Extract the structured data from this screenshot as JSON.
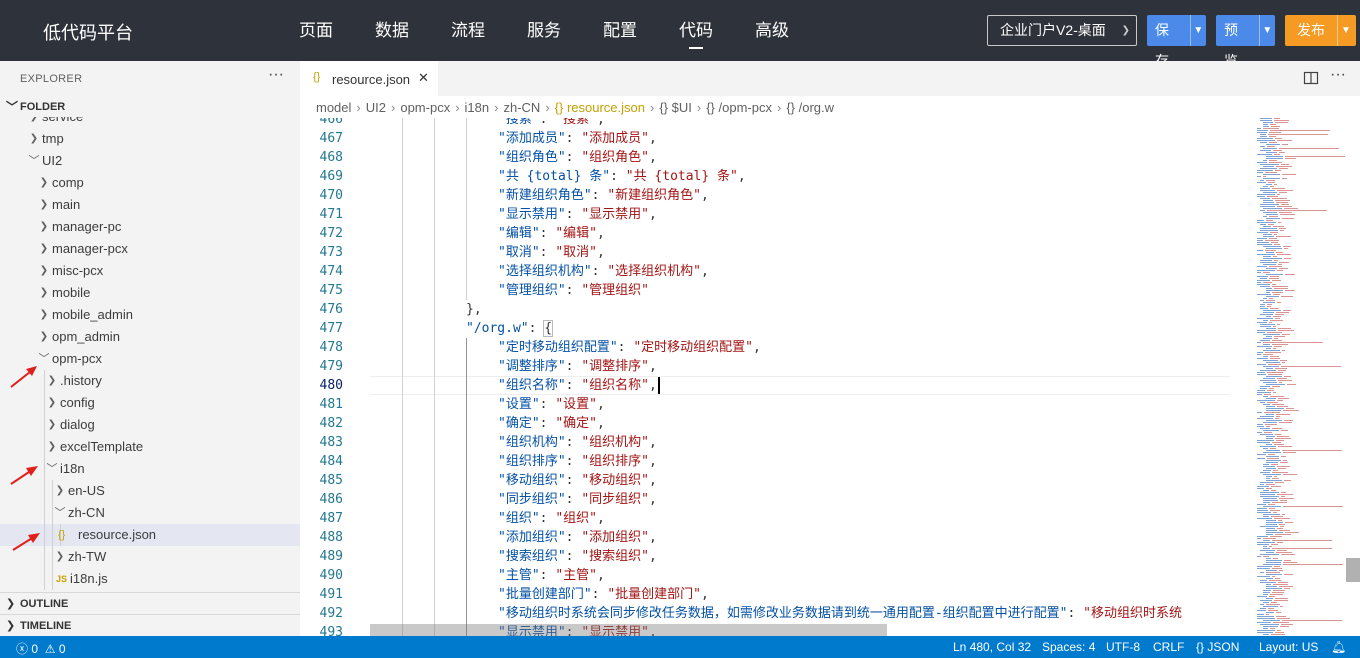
{
  "app": {
    "title": "低代码平台",
    "nav": [
      "页面",
      "数据",
      "流程",
      "服务",
      "配置",
      "代码",
      "高级"
    ],
    "active_nav": "代码",
    "env_select": "企业门户V2-桌面",
    "save_label": "保存",
    "preview_label": "预览",
    "publish_label": "发布",
    "accent_color": "#4b8ae9",
    "publish_color": "#f59a23"
  },
  "sidebar": {
    "header": "EXPLORER",
    "folder_label": "FOLDER",
    "tree": [
      {
        "label": "service",
        "indent": 1,
        "type": "folder",
        "expanded": false
      },
      {
        "label": "tmp",
        "indent": 1,
        "type": "folder",
        "expanded": false
      },
      {
        "label": "UI2",
        "indent": 1,
        "type": "folder",
        "expanded": true
      },
      {
        "label": "comp",
        "indent": 2,
        "type": "folder",
        "expanded": false
      },
      {
        "label": "main",
        "indent": 2,
        "type": "folder",
        "expanded": false
      },
      {
        "label": "manager-pc",
        "indent": 2,
        "type": "folder",
        "expanded": false
      },
      {
        "label": "manager-pcx",
        "indent": 2,
        "type": "folder",
        "expanded": false
      },
      {
        "label": "misc-pcx",
        "indent": 2,
        "type": "folder",
        "expanded": false
      },
      {
        "label": "mobile",
        "indent": 2,
        "type": "folder",
        "expanded": false
      },
      {
        "label": "mobile_admin",
        "indent": 2,
        "type": "folder",
        "expanded": false
      },
      {
        "label": "opm_admin",
        "indent": 2,
        "type": "folder",
        "expanded": false
      },
      {
        "label": "opm-pcx",
        "indent": 2,
        "type": "folder",
        "expanded": true
      },
      {
        "label": ".history",
        "indent": 3,
        "type": "folder",
        "expanded": false
      },
      {
        "label": "config",
        "indent": 3,
        "type": "folder",
        "expanded": false
      },
      {
        "label": "dialog",
        "indent": 3,
        "type": "folder",
        "expanded": false
      },
      {
        "label": "excelTemplate",
        "indent": 3,
        "type": "folder",
        "expanded": false
      },
      {
        "label": "i18n",
        "indent": 3,
        "type": "folder",
        "expanded": true
      },
      {
        "label": "en-US",
        "indent": 4,
        "type": "folder",
        "expanded": false
      },
      {
        "label": "zh-CN",
        "indent": 4,
        "type": "folder",
        "expanded": true
      },
      {
        "label": "resource.json",
        "indent": 5,
        "type": "json",
        "selected": true
      },
      {
        "label": "zh-TW",
        "indent": 4,
        "type": "folder",
        "expanded": false
      },
      {
        "label": "i18n.js",
        "indent": 4,
        "type": "js"
      }
    ],
    "outline_label": "OUTLINE",
    "timeline_label": "TIMELINE"
  },
  "editor": {
    "tab_name": "resource.json",
    "breadcrumb": [
      "model",
      "UI2",
      "opm-pcx",
      "i18n",
      "zh-CN",
      "{} resource.json",
      "{} $UI",
      "{} /opm-pcx",
      "{} /org.w"
    ],
    "current_line": 480,
    "lines": [
      {
        "n": 466,
        "indent": 4,
        "key": "搜索",
        "val": "搜索",
        "trail": ","
      },
      {
        "n": 467,
        "indent": 4,
        "key": "添加成员",
        "val": "添加成员",
        "trail": ","
      },
      {
        "n": 468,
        "indent": 4,
        "key": "组织角色",
        "val": "组织角色",
        "trail": ","
      },
      {
        "n": 469,
        "indent": 4,
        "key": "共 {total} 条",
        "val": "共 {total} 条",
        "trail": ","
      },
      {
        "n": 470,
        "indent": 4,
        "key": "新建组织角色",
        "val": "新建组织角色",
        "trail": ","
      },
      {
        "n": 471,
        "indent": 4,
        "key": "显示禁用",
        "val": "显示禁用",
        "trail": ","
      },
      {
        "n": 472,
        "indent": 4,
        "key": "编辑",
        "val": "编辑",
        "trail": ","
      },
      {
        "n": 473,
        "indent": 4,
        "key": "取消",
        "val": "取消",
        "trail": ","
      },
      {
        "n": 474,
        "indent": 4,
        "key": "选择组织机构",
        "val": "选择组织机构",
        "trail": ","
      },
      {
        "n": 475,
        "indent": 4,
        "key": "管理组织",
        "val": "管理组织",
        "trail": ""
      },
      {
        "n": 476,
        "indent": 3,
        "raw": "},"
      },
      {
        "n": 477,
        "indent": 3,
        "key": "/org.w",
        "open": "{"
      },
      {
        "n": 478,
        "indent": 4,
        "key": "定时移动组织配置",
        "val": "定时移动组织配置",
        "trail": ","
      },
      {
        "n": 479,
        "indent": 4,
        "key": "调整排序",
        "val": "调整排序",
        "trail": ","
      },
      {
        "n": 480,
        "indent": 4,
        "key": "组织名称",
        "val": "组织名称",
        "trail": ","
      },
      {
        "n": 481,
        "indent": 4,
        "key": "设置",
        "val": "设置",
        "trail": ","
      },
      {
        "n": 482,
        "indent": 4,
        "key": "确定",
        "val": "确定",
        "trail": ","
      },
      {
        "n": 483,
        "indent": 4,
        "key": "组织机构",
        "val": "组织机构",
        "trail": ","
      },
      {
        "n": 484,
        "indent": 4,
        "key": "组织排序",
        "val": "组织排序",
        "trail": ","
      },
      {
        "n": 485,
        "indent": 4,
        "key": "移动组织",
        "val": "移动组织",
        "trail": ","
      },
      {
        "n": 486,
        "indent": 4,
        "key": "同步组织",
        "val": "同步组织",
        "trail": ","
      },
      {
        "n": 487,
        "indent": 4,
        "key": "组织",
        "val": "组织",
        "trail": ","
      },
      {
        "n": 488,
        "indent": 4,
        "key": "添加组织",
        "val": "添加组织",
        "trail": ","
      },
      {
        "n": 489,
        "indent": 4,
        "key": "搜索组织",
        "val": "搜索组织",
        "trail": ","
      },
      {
        "n": 490,
        "indent": 4,
        "key": "主管",
        "val": "主管",
        "trail": ","
      },
      {
        "n": 491,
        "indent": 4,
        "key": "批量创建部门",
        "val": "批量创建部门",
        "trail": ","
      },
      {
        "n": 492,
        "indent": 4,
        "key": "移动组织时系统会同步修改任务数据，如需修改业务数据请到统一通用配置-组织配置中进行配置",
        "val": "移动组织时系统",
        "trail": ""
      },
      {
        "n": 493,
        "indent": 4,
        "key": "显示禁用",
        "val": "显示禁用",
        "trail": ","
      }
    ]
  },
  "status": {
    "errors": "0",
    "warnings": "0",
    "position": "Ln 480, Col 32",
    "spaces": "Spaces: 4",
    "encoding": "UTF-8",
    "eol": "CRLF",
    "language": "JSON",
    "layout": "Layout: US",
    "bar_color": "#007acc"
  }
}
